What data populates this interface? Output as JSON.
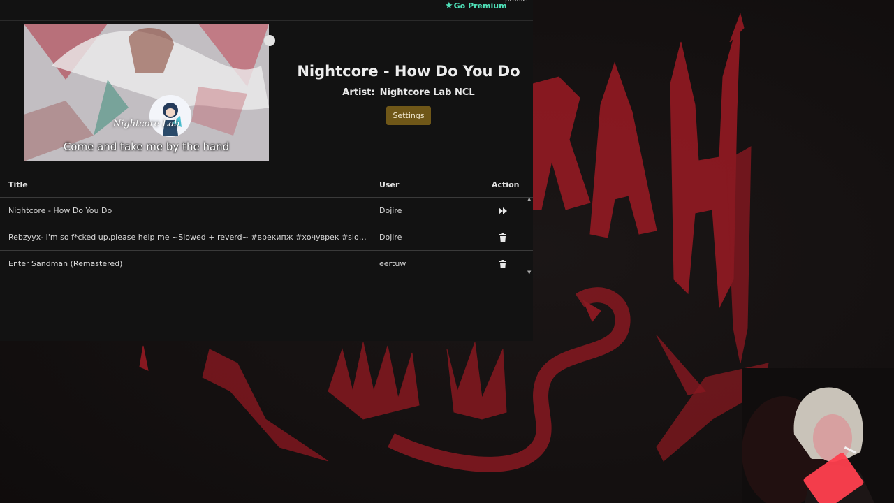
{
  "topbar": {
    "premium_label": "Go Premium",
    "premium_icon": "star-icon",
    "profile_label": "profile"
  },
  "now_playing": {
    "thumbnail": {
      "channel_name": "Nightcore Lab",
      "lyric": "Come and take me by the hand"
    },
    "title": "Nightcore - How Do You Do",
    "artist_label": "Artist:",
    "artist_name": "Nightcore Lab NCL",
    "settings_label": "Settings"
  },
  "queue": {
    "columns": {
      "title": "Title",
      "user": "User",
      "action": "Action"
    },
    "rows": [
      {
        "title": "Nightcore - How Do You Do",
        "user": "Dojire",
        "action_icon": "skip-forward-icon"
      },
      {
        "title": "Rebzyyx- I'm so f*cked up,please help me ~Slowed + reverd~ #врекипж #хочуврек #slowedandreve...",
        "user": "Dojire",
        "action_icon": "trash-icon"
      },
      {
        "title": "Enter Sandman (Remastered)",
        "user": "eertuw",
        "action_icon": "trash-icon"
      }
    ]
  },
  "colors": {
    "accent_premium": "#4fe0b8",
    "settings_button": "#6f5718",
    "artwork_red": "#8e1a22",
    "panel_bg": "#121212"
  }
}
